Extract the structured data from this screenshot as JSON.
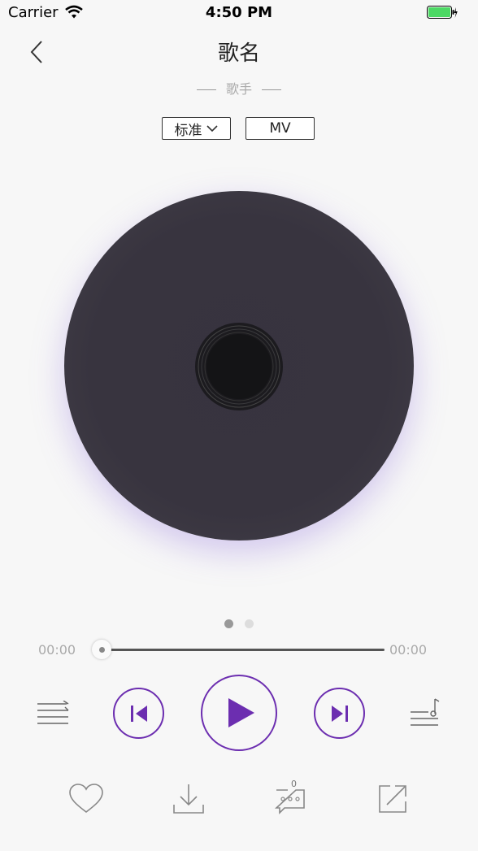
{
  "status_bar": {
    "carrier": "Carrier",
    "time": "4:50 PM",
    "battery_color": "#4cd964"
  },
  "header": {
    "title": "歌名",
    "artist": "歌手",
    "back_icon": "chevron-left-icon"
  },
  "options": {
    "quality_label": "标准",
    "mv_label": "MV"
  },
  "pager": {
    "active_index": 0,
    "count": 2
  },
  "player": {
    "current_time": "00:00",
    "total_time": "00:00",
    "progress": 0,
    "accent_color": "#6c2eb0"
  },
  "actions": {
    "comment_count": "0"
  },
  "icons": {
    "playlist": "playlist-icon",
    "previous": "previous-icon",
    "play": "play-icon",
    "next": "next-icon",
    "lyrics": "lyrics-icon",
    "like": "heart-icon",
    "download": "download-icon",
    "comment": "comment-icon",
    "share": "share-icon"
  }
}
